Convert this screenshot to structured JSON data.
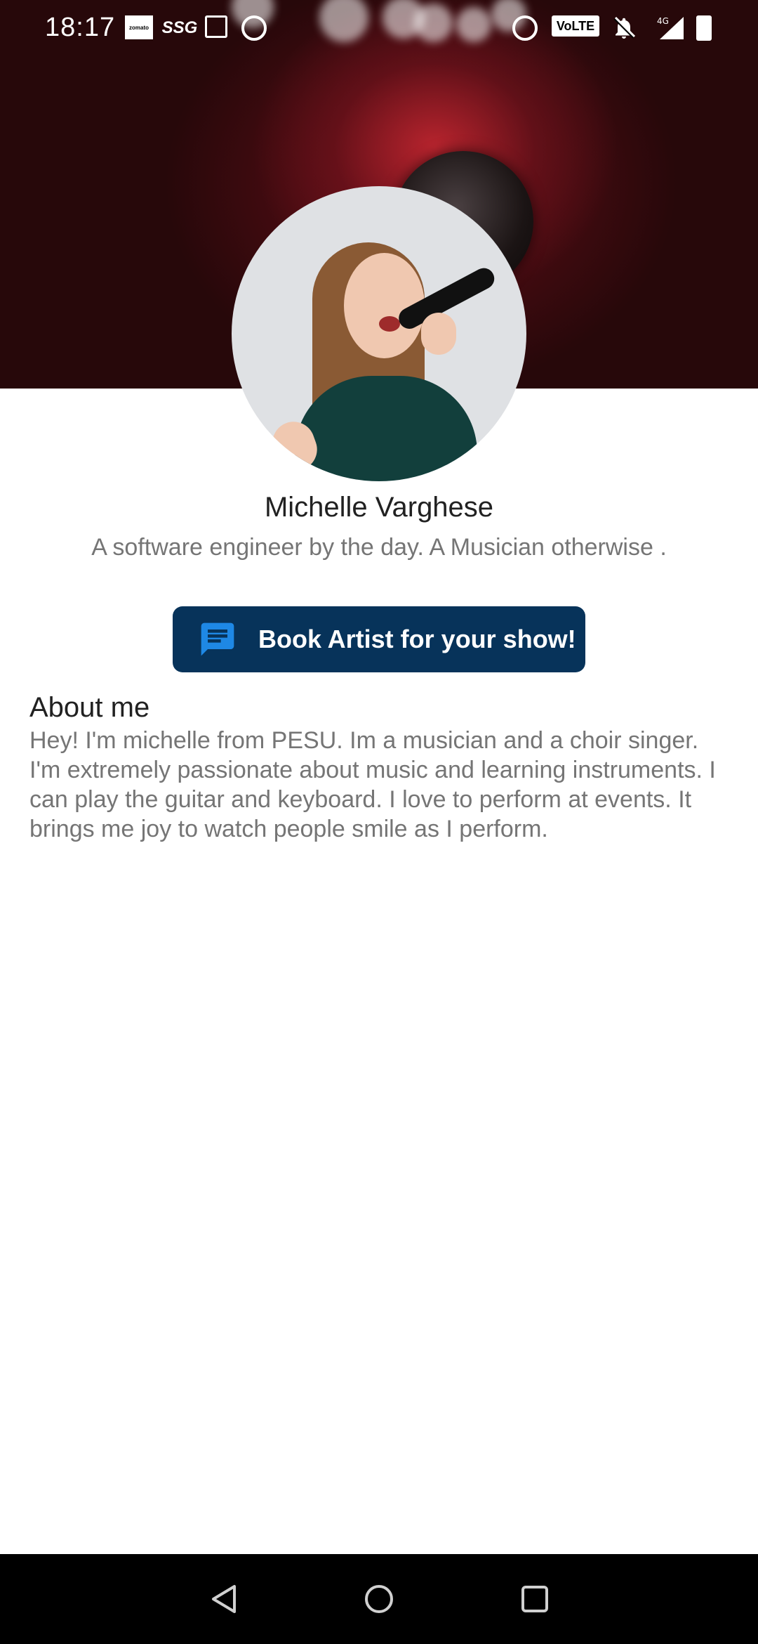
{
  "status_bar": {
    "time": "18:17",
    "icons": [
      "zomato-icon",
      "ssg-icon",
      "gallery-icon",
      "no-drive-icon",
      "alarm-icon",
      "volte-icon",
      "bell-off-icon",
      "signal-4g-icon",
      "battery-icon"
    ],
    "zomato_label": "zomato",
    "ssg_label": "SSG",
    "volte_label": "VoLTE",
    "network_label": "4G"
  },
  "profile": {
    "name": "Michelle Varghese",
    "tagline": "A software engineer by the day. A Musician otherwise ."
  },
  "actions": {
    "book_label": "Book Artist for your show!",
    "book_icon": "chat-icon",
    "button_color": "#07335a",
    "icon_color": "#1e88e5"
  },
  "about": {
    "title": "About me",
    "body": "Hey! I'm michelle from PESU. Im a musician and a choir singer. I'm extremely passionate about music and learning instruments. I can play the guitar and keyboard. I love to perform at events. It brings me joy to watch people smile as I perform."
  },
  "nav_bar": {
    "buttons": [
      "back-icon",
      "home-icon",
      "recents-icon"
    ]
  }
}
